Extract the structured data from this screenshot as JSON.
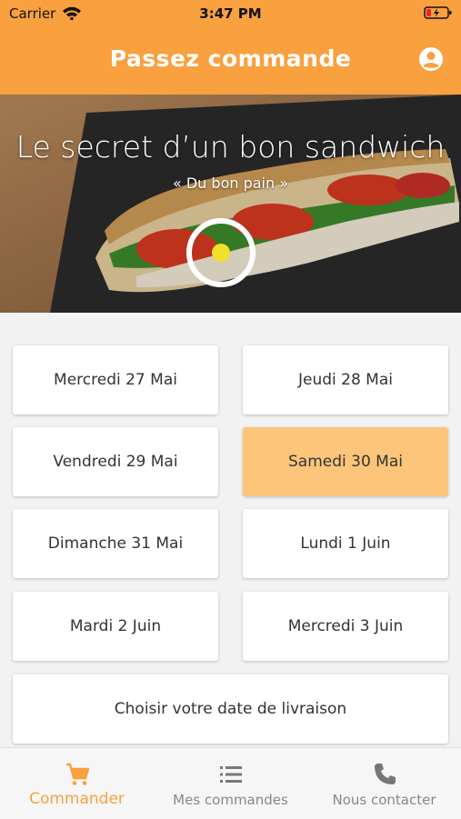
{
  "status_bar": {
    "carrier": "Carrier",
    "time": "3:47 PM",
    "icons": [
      "wifi-icon",
      "battery-charging-icon"
    ]
  },
  "app_bar": {
    "title": "Passez commande",
    "account_icon": "account-circle-icon"
  },
  "hero": {
    "headline": "Le secret d’un bon sandwich",
    "tagline": "« Du bon pain »"
  },
  "dates": [
    {
      "label": "Mercredi 27 Mai",
      "selected": false
    },
    {
      "label": "Jeudi 28 Mai",
      "selected": false
    },
    {
      "label": "Vendredi 29 Mai",
      "selected": false
    },
    {
      "label": "Samedi 30 Mai",
      "selected": true
    },
    {
      "label": "Dimanche 31 Mai",
      "selected": false
    },
    {
      "label": "Lundi 1 Juin",
      "selected": false
    },
    {
      "label": "Mardi 2 Juin",
      "selected": false
    },
    {
      "label": "Mercredi 3 Juin",
      "selected": false
    }
  ],
  "choose_date_label": "Choisir votre date de livraison",
  "bottom_nav": [
    {
      "label": "Commander",
      "icon": "cart-icon",
      "active": true
    },
    {
      "label": "Mes commandes",
      "icon": "list-icon",
      "active": false
    },
    {
      "label": "Nous contacter",
      "icon": "phone-icon",
      "active": false
    }
  ],
  "colors": {
    "primary": "#f9a03f",
    "selected_date": "#fcc57a",
    "marker_dot": "#f0e12a",
    "inactive": "#888888"
  }
}
